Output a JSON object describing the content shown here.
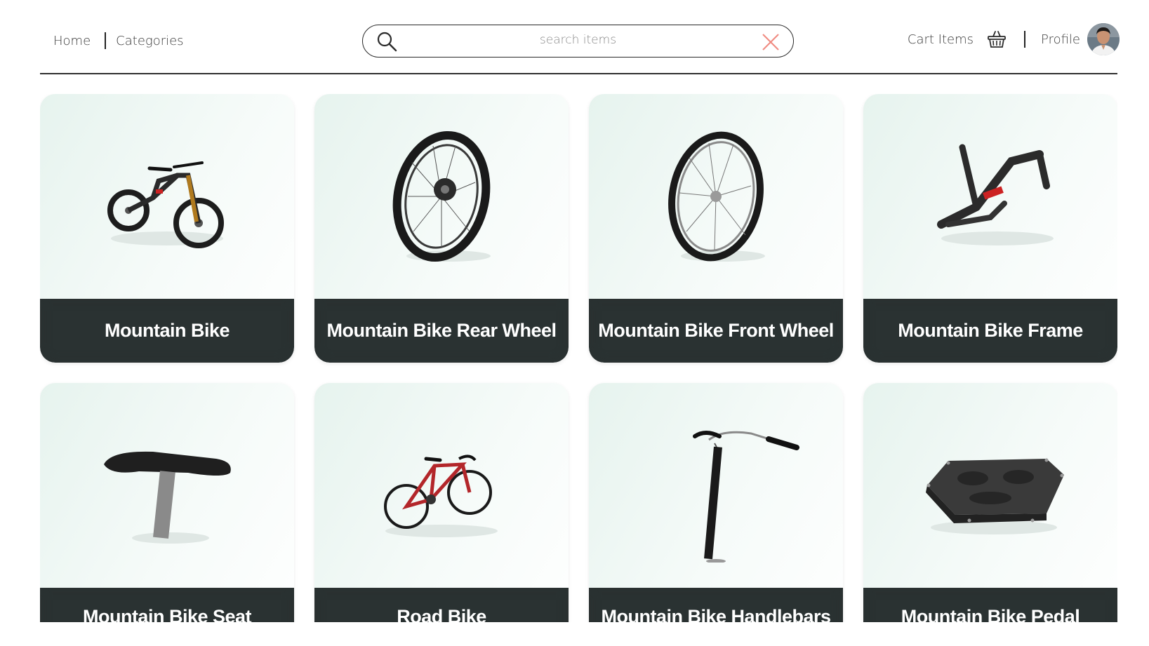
{
  "header": {
    "home_label": "Home",
    "categories_label": "Categories",
    "cart_label": "Cart Items",
    "profile_label": "Profile"
  },
  "search": {
    "placeholder": "search items",
    "value": "",
    "search_icon": "search-icon",
    "clear_icon": "close-icon",
    "clear_icon_color": "#f08a80"
  },
  "icons": {
    "cart": "basket-icon",
    "avatar": "avatar"
  },
  "products": [
    {
      "name": "Mountain Bike",
      "icon": "mountain-bike-image"
    },
    {
      "name": "Mountain Bike Rear Wheel",
      "icon": "rear-wheel-image"
    },
    {
      "name": "Mountain Bike Front Wheel",
      "icon": "front-wheel-image"
    },
    {
      "name": "Mountain Bike Frame",
      "icon": "bike-frame-image"
    },
    {
      "name": "Mountain Bike Seat",
      "icon": "bike-seat-image"
    },
    {
      "name": "Road Bike",
      "icon": "road-bike-image"
    },
    {
      "name": "Mountain Bike Handlebars",
      "icon": "handlebars-image"
    },
    {
      "name": "Mountain Bike Pedal",
      "icon": "pedal-image"
    }
  ],
  "colors": {
    "card_label_bg": "#2a3232",
    "card_bg_tint": "#e6f3ee",
    "road_bike_frame": "#b3262a"
  }
}
